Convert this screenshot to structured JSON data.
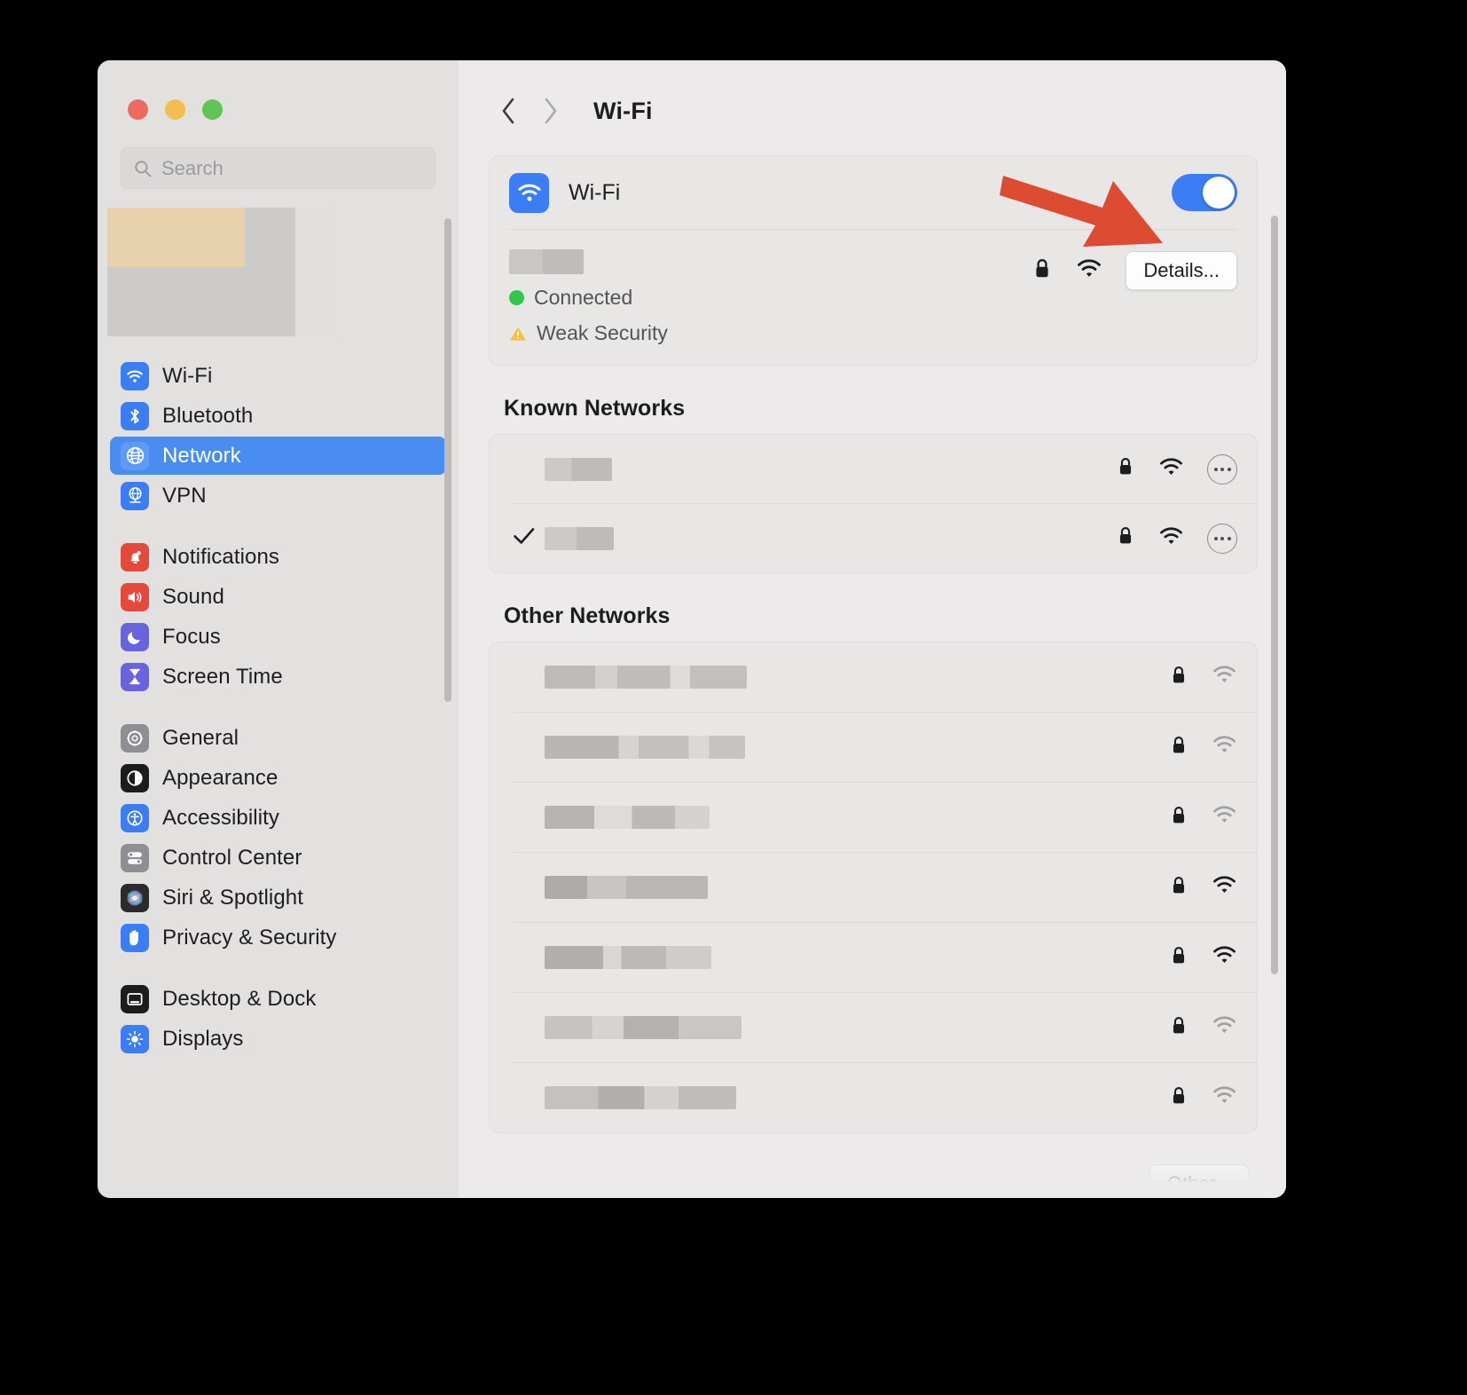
{
  "window": {
    "traffic_lights": [
      {
        "name": "close",
        "color": "#ec6a5f"
      },
      {
        "name": "minimize",
        "color": "#f4bd4f"
      },
      {
        "name": "zoom",
        "color": "#61c555"
      }
    ]
  },
  "search": {
    "placeholder": "Search",
    "value": "",
    "icon": "search-icon"
  },
  "sidebar": {
    "profile": {
      "redacted": true
    },
    "groups": [
      {
        "items": [
          {
            "label": "Wi-Fi",
            "icon": "wifi-icon",
            "icon_bg": "#3b7df4",
            "selected": false
          },
          {
            "label": "Bluetooth",
            "icon": "bluetooth-icon",
            "icon_bg": "#3b7df4",
            "selected": false
          },
          {
            "label": "Network",
            "icon": "globe-icon",
            "icon_bg": "#3b7df4",
            "selected": true
          },
          {
            "label": "VPN",
            "icon": "vpn-icon",
            "icon_bg": "#3b7df4",
            "selected": false
          }
        ]
      },
      {
        "items": [
          {
            "label": "Notifications",
            "icon": "bell-icon",
            "icon_bg": "#e4493c",
            "selected": false
          },
          {
            "label": "Sound",
            "icon": "speaker-icon",
            "icon_bg": "#e4493c",
            "selected": false
          },
          {
            "label": "Focus",
            "icon": "moon-icon",
            "icon_bg": "#6a63e0",
            "selected": false
          },
          {
            "label": "Screen Time",
            "icon": "hourglass-icon",
            "icon_bg": "#6a63e0",
            "selected": false
          }
        ]
      },
      {
        "items": [
          {
            "label": "General",
            "icon": "gear-icon",
            "icon_bg": "#8e8e93",
            "selected": false
          },
          {
            "label": "Appearance",
            "icon": "appearance-icon",
            "icon_bg": "#1c1c1e",
            "selected": false
          },
          {
            "label": "Accessibility",
            "icon": "accessibility-icon",
            "icon_bg": "#3b7df4",
            "selected": false
          },
          {
            "label": "Control Center",
            "icon": "sliders-icon",
            "icon_bg": "#8e8e93",
            "selected": false
          },
          {
            "label": "Siri & Spotlight",
            "icon": "siri-icon",
            "icon_bg": "#2b2b2d",
            "selected": false
          },
          {
            "label": "Privacy & Security",
            "icon": "hand-icon",
            "icon_bg": "#3b7df4",
            "selected": false
          }
        ]
      },
      {
        "items": [
          {
            "label": "Desktop & Dock",
            "icon": "desktop-dock-icon",
            "icon_bg": "#1c1c1e",
            "selected": false
          },
          {
            "label": "Displays",
            "icon": "display-icon",
            "icon_bg": "#3b7df4",
            "selected": false
          }
        ]
      }
    ]
  },
  "toolbar": {
    "back_icon": "chevron-left-icon",
    "forward_icon": "chevron-right-icon",
    "title": "Wi-Fi"
  },
  "wifi_card": {
    "icon": "wifi-icon",
    "label": "Wi-Fi",
    "toggle": {
      "state": "on",
      "accent": "#3b7df4"
    },
    "current_network": {
      "ssid_redacted": true,
      "status_label": "Connected",
      "status_color": "#30c84a",
      "warning_label": "Weak Security",
      "warning_color": "#f5c343",
      "lock_icon": "lock-icon",
      "signal_icon": "wifi-signal-icon",
      "details_button": "Details..."
    }
  },
  "known_networks": {
    "title": "Known Networks",
    "rows": [
      {
        "checked": false,
        "blur_width": 76,
        "lock_icon": "lock-icon",
        "signal_icon": "wifi-signal-icon",
        "signal_strength": "full",
        "more_icon": "ellipsis-icon"
      },
      {
        "checked": true,
        "blur_width": 78,
        "lock_icon": "lock-icon",
        "signal_icon": "wifi-signal-icon",
        "signal_strength": "full",
        "more_icon": "ellipsis-icon"
      }
    ],
    "check_icon": "checkmark-icon"
  },
  "other_networks": {
    "title": "Other Networks",
    "rows": [
      {
        "blur_width": 228,
        "lock_icon": "lock-icon",
        "signal_icon": "wifi-signal-icon",
        "signal_strength": "weak"
      },
      {
        "blur_width": 226,
        "lock_icon": "lock-icon",
        "signal_icon": "wifi-signal-icon",
        "signal_strength": "weak"
      },
      {
        "blur_width": 186,
        "lock_icon": "lock-icon",
        "signal_icon": "wifi-signal-icon",
        "signal_strength": "weak"
      },
      {
        "blur_width": 184,
        "lock_icon": "lock-icon",
        "signal_icon": "wifi-signal-icon",
        "signal_strength": "full"
      },
      {
        "blur_width": 188,
        "lock_icon": "lock-icon",
        "signal_icon": "wifi-signal-icon",
        "signal_strength": "full"
      },
      {
        "blur_width": 222,
        "lock_icon": "lock-icon",
        "signal_icon": "wifi-signal-icon",
        "signal_strength": "weak"
      },
      {
        "blur_width": 216,
        "lock_icon": "lock-icon",
        "signal_icon": "wifi-signal-icon",
        "signal_strength": "weak"
      }
    ],
    "other_button": "Other..."
  },
  "annotation": {
    "arrow": {
      "color": "#dd4b33",
      "points_to": "details-button"
    }
  }
}
